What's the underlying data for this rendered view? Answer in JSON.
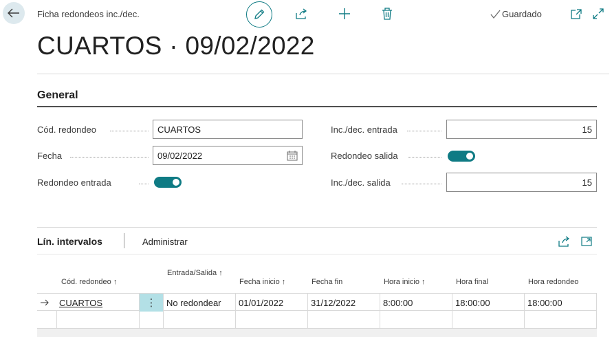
{
  "header": {
    "breadcrumb": "Ficha redondeos inc./dec.",
    "saved_label": "Guardado",
    "title": "CUARTOS · 09/02/2022"
  },
  "general": {
    "section_title": "General",
    "fields": {
      "cod_redondeo": {
        "label": "Cód. redondeo",
        "value": "CUARTOS"
      },
      "fecha": {
        "label": "Fecha",
        "value": "09/02/2022"
      },
      "redondeo_entrada": {
        "label": "Redondeo entrada",
        "on": true
      },
      "inc_dec_entrada": {
        "label": "Inc./dec. entrada",
        "value": "15"
      },
      "redondeo_salida": {
        "label": "Redondeo salida",
        "on": true
      },
      "inc_dec_salida": {
        "label": "Inc./dec. salida",
        "value": "15"
      }
    }
  },
  "lines": {
    "title": "Lín. intervalos",
    "manage_label": "Administrar",
    "columns": [
      "Cód. redondeo ↑",
      "Entrada/Salida ↑",
      "Fecha inicio ↑",
      "Fecha fin",
      "Hora inicio ↑",
      "Hora final",
      "Hora redondeo"
    ],
    "rows": [
      {
        "cod": "CUARTOS",
        "entrada_salida": "No redondear",
        "fecha_inicio": "01/01/2022",
        "fecha_fin": "31/12/2022",
        "hora_inicio": "8:00:00",
        "hora_final": "18:00:00",
        "hora_redondeo": "18:00:00"
      }
    ]
  },
  "colors": {
    "accent": "#0f7b84",
    "back_bg": "#dde9ee",
    "selected_cell": "#b3e0e6"
  },
  "icons": [
    "back-arrow-icon",
    "pencil-icon",
    "share-icon",
    "plus-icon",
    "trash-icon",
    "check-icon",
    "open-new-window-icon",
    "expand-icon",
    "calendar-icon",
    "row-arrow-icon",
    "more-options-icon"
  ]
}
